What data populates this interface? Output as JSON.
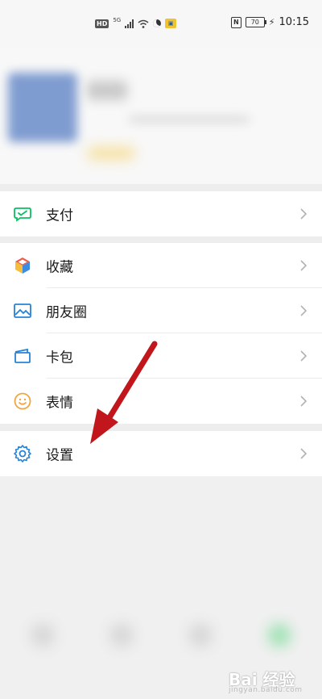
{
  "status_bar": {
    "hd": "HD",
    "network": "5G",
    "battery_level": "70",
    "time": "10:15",
    "icons": [
      "signal-icon",
      "wifi-icon",
      "moon-icon",
      "nfc-icon",
      "battery-icon",
      "charging-icon"
    ]
  },
  "profile": {
    "blurred": true
  },
  "menu": {
    "section_pay": [
      {
        "label": "支付",
        "icon": "pay-icon",
        "color": "#07c160"
      }
    ],
    "section_main": [
      {
        "label": "收藏",
        "icon": "favorites-icon"
      },
      {
        "label": "朋友圈",
        "icon": "moments-icon",
        "color": "#2782d7"
      },
      {
        "label": "卡包",
        "icon": "card-wallet-icon",
        "color": "#2782d7"
      },
      {
        "label": "表情",
        "icon": "sticker-icon",
        "color": "#f0a542"
      }
    ],
    "section_settings": [
      {
        "label": "设置",
        "icon": "settings-icon",
        "color": "#2782d7"
      }
    ]
  },
  "annotation": {
    "arrow_color": "#c0161c"
  },
  "watermark": {
    "text": "Bai 经验",
    "sub": "jingyan.baidu.com"
  }
}
